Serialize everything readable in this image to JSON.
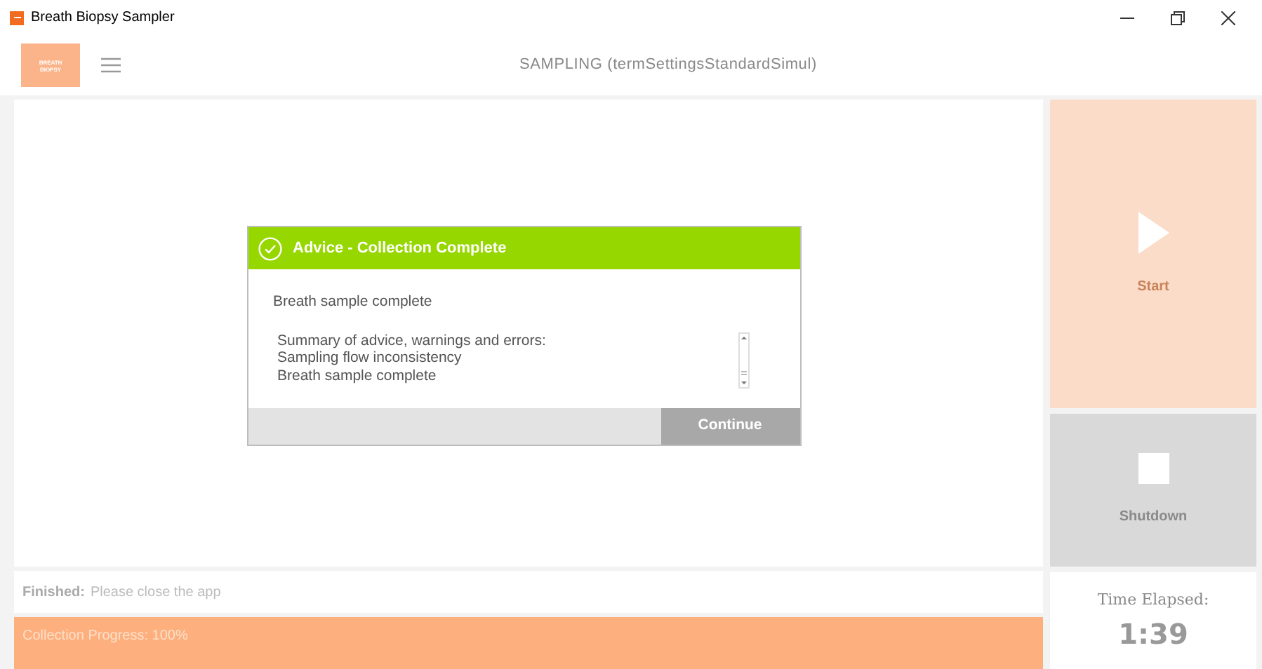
{
  "window": {
    "title": "Breath Biopsy Sampler"
  },
  "header": {
    "logo_lines": [
      "BREATH",
      "BIOPSY"
    ],
    "title": "SAMPLING (termSettingsStandardSimul)"
  },
  "dialog": {
    "kind": "advice",
    "title": "Advice - Collection Complete",
    "message": "Breath sample complete",
    "summary": [
      "Summary of advice, warnings and errors:",
      "Sampling flow inconsistency",
      "Breath sample complete"
    ],
    "button": "Continue"
  },
  "status": {
    "label": "Finished:",
    "text": "Please close the app"
  },
  "progress": {
    "label": "Collection Progress: 100%",
    "level": 1
  },
  "controls": [
    {
      "kind": "start",
      "label": "Start",
      "disabled": true
    },
    {
      "kind": "stop",
      "label": "Shutdown",
      "disabled": true
    }
  ],
  "timer": {
    "label": "Time Elapsed:",
    "value": "1:39"
  }
}
